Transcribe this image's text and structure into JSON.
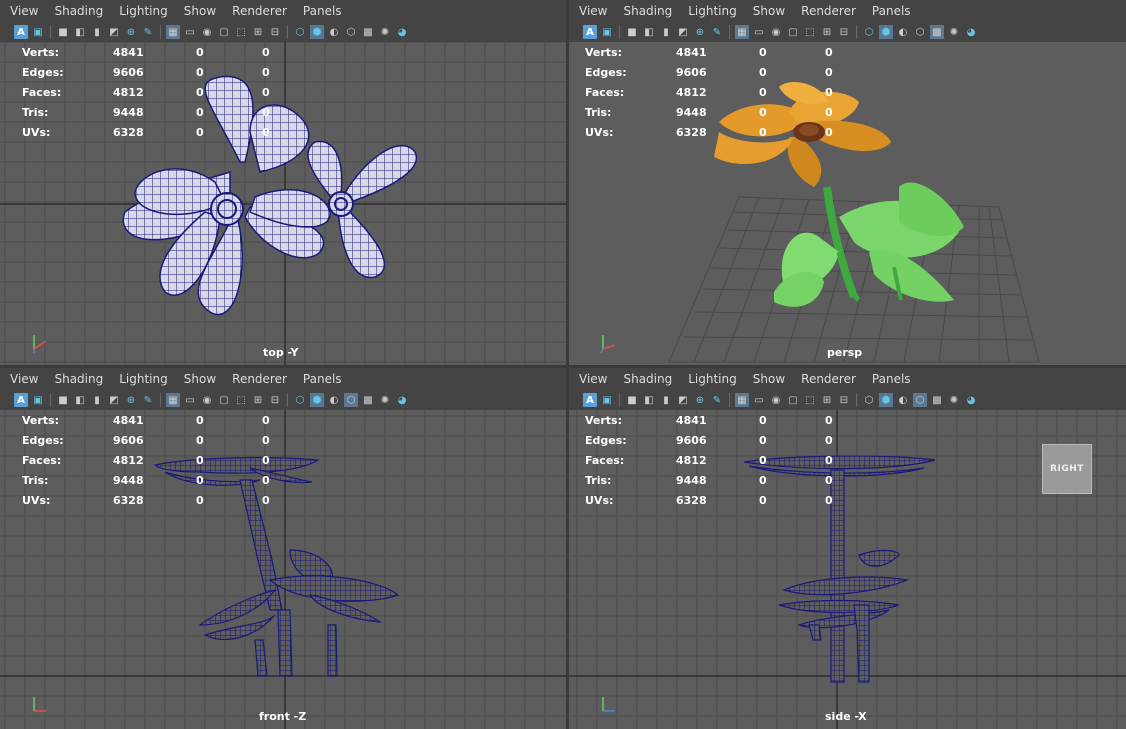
{
  "menus": [
    "View",
    "Shading",
    "Lighting",
    "Show",
    "Renderer",
    "Panels"
  ],
  "hud": {
    "rows": [
      {
        "label": "Verts:",
        "v1": "4841",
        "v2": "0",
        "v3": "0"
      },
      {
        "label": "Edges:",
        "v1": "9606",
        "v2": "0",
        "v3": "0"
      },
      {
        "label": "Faces:",
        "v1": "4812",
        "v2": "0",
        "v3": "0"
      },
      {
        "label": "Tris:",
        "v1": "9448",
        "v2": "0",
        "v3": "0"
      },
      {
        "label": "UVs:",
        "v1": "6328",
        "v2": "0",
        "v3": "0"
      }
    ]
  },
  "viewports": {
    "top": {
      "camera": "top -Y"
    },
    "persp": {
      "camera": "persp"
    },
    "front": {
      "camera": "front -Z"
    },
    "side": {
      "camera": "side -X",
      "view_cube": "RIGHT"
    }
  },
  "toolbar_icons": [
    "select-camera-icon",
    "camera-attr-icon",
    "bookmark-icon",
    "image-plane-icon",
    "2d-pan-icon",
    "grease-pencil-icon",
    "grid-icon",
    "film-gate-icon",
    "resolution-gate-icon",
    "gate-mask-icon",
    "field-chart-icon",
    "safe-action-icon",
    "wireframe-icon",
    "smooth-shade-icon",
    "default-material-icon",
    "wireframe-on-shaded-icon",
    "xray-icon",
    "lights-icon",
    "shadows-icon"
  ],
  "colors": {
    "viewport_bg": "#5d5d5d",
    "grid": "#4b4b4b",
    "wire": "#1a1a7a",
    "accent": "#5a9fd6"
  }
}
